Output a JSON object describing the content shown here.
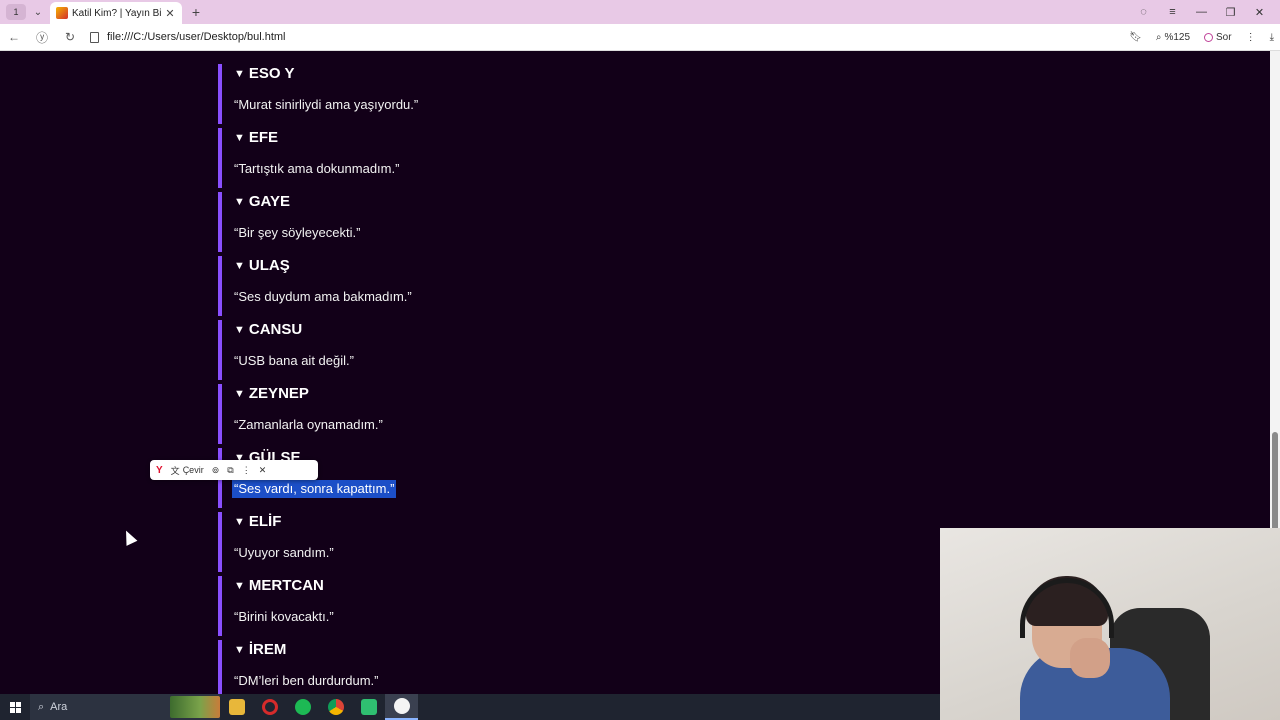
{
  "browser": {
    "tab_count": "1",
    "tab_title": "Katil Kim? | Yayın Bi",
    "url": "file:///C:/Users/user/Desktop/bul.html",
    "zoom": "%125",
    "ask_label": "Sor"
  },
  "entries": [
    {
      "name": "ESO Y",
      "quote": "“Murat sinirliydi ama yaşıyordu.”",
      "selected": false
    },
    {
      "name": "EFE",
      "quote": "“Tartıştık ama dokunmadım.”",
      "selected": false
    },
    {
      "name": "GAYE",
      "quote": "“Bir şey söyleyecekti.”",
      "selected": false
    },
    {
      "name": "ULAŞ",
      "quote": "“Ses duydum ama bakmadım.”",
      "selected": false
    },
    {
      "name": "CANSU",
      "quote": "“USB bana ait değil.”",
      "selected": false
    },
    {
      "name": "ZEYNEP",
      "quote": "“Zamanlarla oynamadım.”",
      "selected": false
    },
    {
      "name": "GÜLSE",
      "quote": "“Ses vardı, sonra kapattım.”",
      "selected": true
    },
    {
      "name": "ELİF",
      "quote": "“Uyuyor sandım.”",
      "selected": false
    },
    {
      "name": "MERTCAN",
      "quote": "“Birini kovacaktı.”",
      "selected": false
    },
    {
      "name": "İREM",
      "quote": "“DM’leri ben durdurdum.”",
      "selected": false
    }
  ],
  "popup": {
    "translate_label": "Çevir"
  },
  "taskbar": {
    "search_placeholder": "Ara"
  },
  "colors": {
    "page_bg": "#120018",
    "accent": "#8a4fff",
    "selection": "#1c4fc7"
  }
}
